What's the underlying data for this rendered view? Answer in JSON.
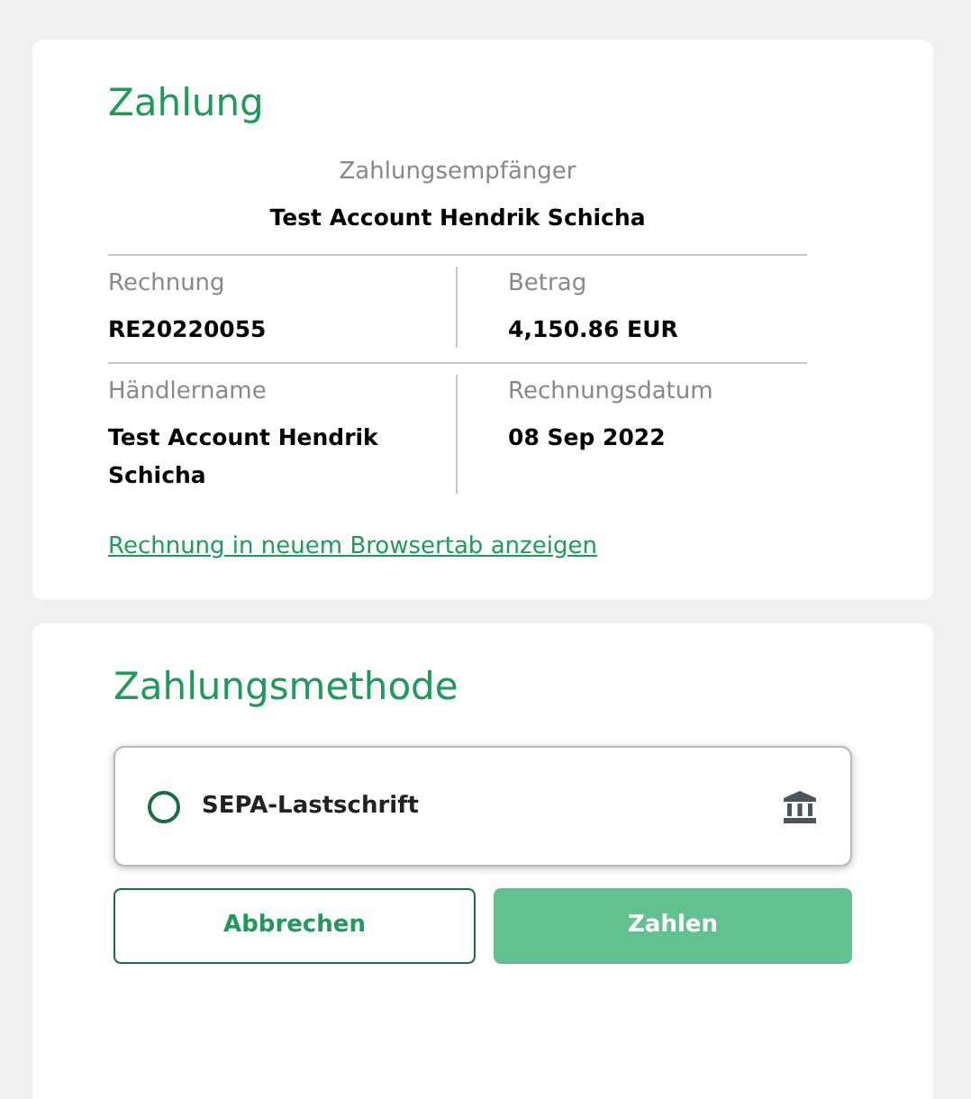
{
  "payment": {
    "title": "Zahlung",
    "recipient_label": "Zahlungsempfänger",
    "recipient": "Test Account Hendrik Schicha",
    "rows": [
      [
        {
          "label": "Rechnung",
          "value": "RE20220055"
        },
        {
          "label": "Betrag",
          "value": "4,150.86 EUR"
        }
      ],
      [
        {
          "label": "Händlername",
          "value": "Test Account Hendrik Schicha"
        },
        {
          "label": "Rechnungsdatum",
          "value": "08 Sep 2022"
        }
      ]
    ],
    "invoice_link": "Rechnung in neuem Browsertab anzeigen"
  },
  "payment_method": {
    "title": "Zahlungsmethode",
    "options": [
      {
        "label": "SEPA-Lastschrift",
        "selected": false
      }
    ],
    "buttons": [
      {
        "label": "Abbrechen",
        "kind": "secondary",
        "disabled": false
      },
      {
        "label": "Zahlen",
        "kind": "primary",
        "disabled": true
      }
    ]
  }
}
